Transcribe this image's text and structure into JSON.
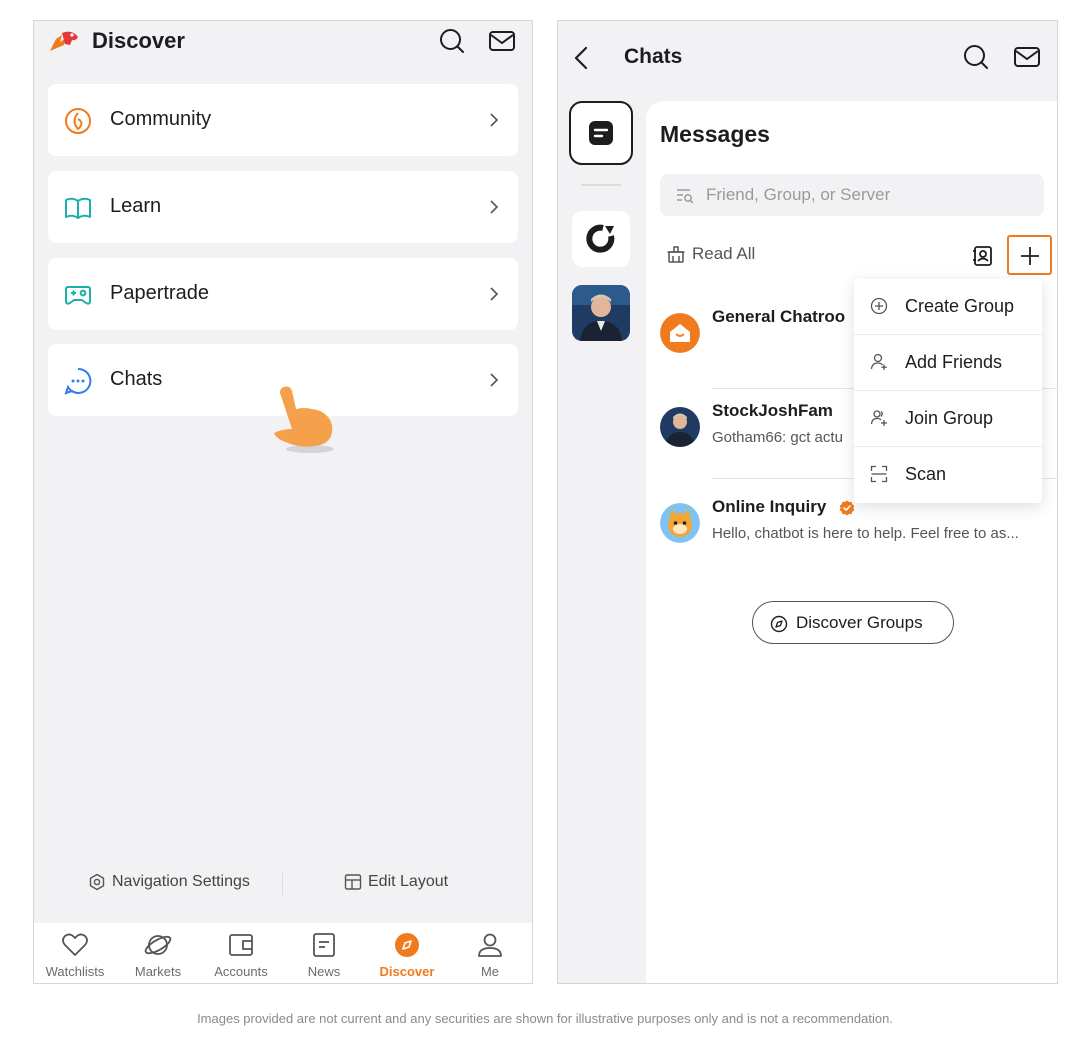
{
  "discover_screen": {
    "header": {
      "title": "Discover",
      "icons": [
        "search-icon",
        "mail-icon"
      ]
    },
    "menu": [
      {
        "label": "Community",
        "icon": "community-icon"
      },
      {
        "label": "Learn",
        "icon": "book-icon"
      },
      {
        "label": "Papertrade",
        "icon": "gamepad-icon"
      },
      {
        "label": "Chats",
        "icon": "chat-bubble-icon"
      }
    ],
    "footer_links": {
      "nav_settings": "Navigation Settings",
      "edit_layout": "Edit Layout"
    },
    "tab_bar": {
      "active": "Discover",
      "tabs": [
        {
          "label": "Watchlists",
          "icon": "heart-icon"
        },
        {
          "label": "Markets",
          "icon": "planet-icon"
        },
        {
          "label": "Accounts",
          "icon": "wallet-icon"
        },
        {
          "label": "News",
          "icon": "news-icon"
        },
        {
          "label": "Discover",
          "icon": "compass-icon"
        },
        {
          "label": "Me",
          "icon": "person-icon"
        }
      ]
    }
  },
  "chats_screen": {
    "topbar": {
      "title": "Chats",
      "icons": [
        "back-icon",
        "search-icon",
        "mail-icon"
      ]
    },
    "messages": {
      "title": "Messages",
      "search_placeholder": "Friend, Group, or Server",
      "read_all": "Read All",
      "conversations": [
        {
          "name": "General Chatroo",
          "preview": "",
          "verified": false
        },
        {
          "name": "StockJoshFam",
          "preview": "Gotham66: gct actu",
          "verified": false
        },
        {
          "name": "Online Inquiry",
          "preview": "Hello, chatbot is here to help. Feel free to as...",
          "verified": true
        }
      ],
      "discover_groups": "Discover Groups"
    },
    "dropdown_menu": [
      {
        "label": "Create Group",
        "icon": "plus-circle-icon"
      },
      {
        "label": "Add Friends",
        "icon": "add-friend-icon"
      },
      {
        "label": "Join Group",
        "icon": "join-group-icon"
      },
      {
        "label": "Scan",
        "icon": "scan-icon"
      }
    ]
  },
  "colors": {
    "accent": "#f07a1e",
    "learn": "#1ab2a8",
    "chats": "#2f7cf6"
  },
  "disclaimer": "Images provided are not current and any securities are shown for illustrative purposes only and is not a recommendation."
}
